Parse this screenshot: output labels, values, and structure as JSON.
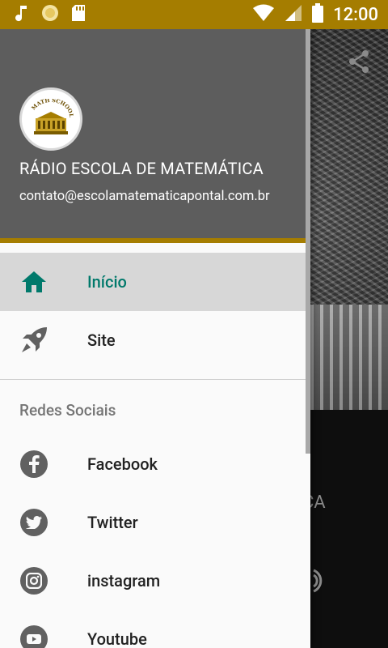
{
  "status_bar": {
    "time": "12:00",
    "icons": [
      "music-note-icon",
      "sun-icon",
      "sd-card-icon",
      "wifi-icon",
      "signal-icon",
      "battery-icon"
    ]
  },
  "background_app": {
    "station_partial": "ICA"
  },
  "drawer": {
    "header": {
      "logo_text": "MATH SCHOOL",
      "title": "RÁDIO ESCOLA DE MATEMÁTICA",
      "email": "contato@escolamatematicapontal.com.br"
    },
    "items": [
      {
        "label": "Início",
        "icon": "home-icon",
        "active": true
      },
      {
        "label": "Site",
        "icon": "rocket-icon",
        "active": false
      }
    ],
    "section_title": "Redes Sociais",
    "social": [
      {
        "label": "Facebook",
        "icon": "facebook-icon"
      },
      {
        "label": "Twitter",
        "icon": "twitter-icon"
      },
      {
        "label": "instagram",
        "icon": "instagram-icon"
      },
      {
        "label": "Youtube",
        "icon": "youtube-icon"
      }
    ]
  },
  "colors": {
    "status_bar": "#a57d00",
    "header_bg": "#5d5d5d",
    "accent": "#00796b",
    "active_bg": "#d7d7d7"
  }
}
